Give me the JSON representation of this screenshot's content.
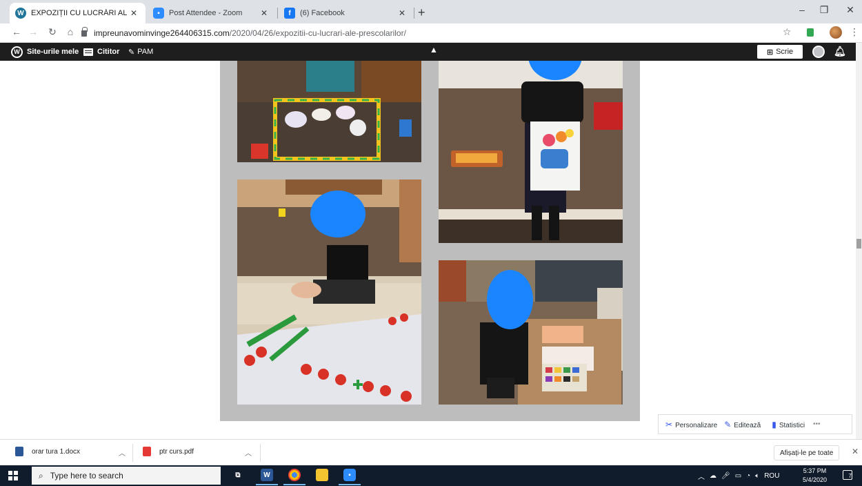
{
  "browser": {
    "tabs": [
      {
        "title": "EXPOZIȚII CU LUCRĂRI ALE PRES",
        "active": true,
        "icon": "wordpress-icon"
      },
      {
        "title": "Post Attendee - Zoom",
        "active": false,
        "icon": "zoom-icon"
      },
      {
        "title": "(6) Facebook",
        "active": false,
        "icon": "facebook-icon"
      }
    ],
    "new_tab": "+",
    "url_host": "impreunavominvinge264406315.com",
    "url_path": "/2020/04/26/expozitii-cu-lucrari-ale-prescolarilor/"
  },
  "wp_admin_bar": {
    "my_sites": "Site-urile mele",
    "reader": "Cititor",
    "site_name": "PAM",
    "write": "Scrie"
  },
  "wp_actions": {
    "customize": "Personalizare",
    "edit": "Editează",
    "stats": "Statistici",
    "more": "•••"
  },
  "downloads": {
    "items": [
      {
        "name": "orar tura 1.docx",
        "icon": "word-doc-icon"
      },
      {
        "name": "ptr curs.pdf",
        "icon": "pdf-icon"
      }
    ],
    "show_all": "Afișați-le pe toate"
  },
  "taskbar": {
    "search_placeholder": "Type here to search",
    "language": "ROU",
    "time": "5:37 PM",
    "date": "5/4/2020",
    "notifications": "7"
  },
  "colors": {
    "blur_blue": "#1a85ff",
    "wp_bar": "#1e1e1e",
    "taskbar": "#101c2c",
    "gallery_bg": "#bdbdbd"
  }
}
